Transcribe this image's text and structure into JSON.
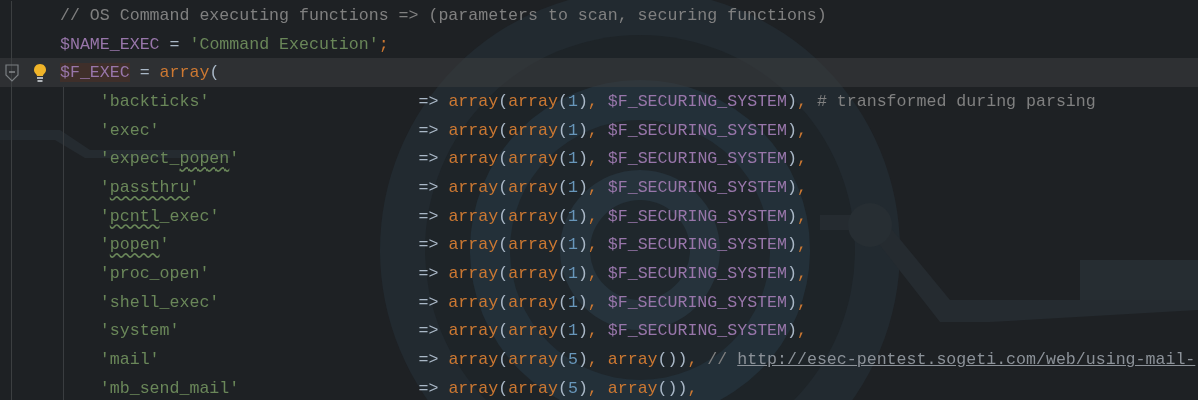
{
  "lines": [
    {
      "current": false,
      "tokens": [
        {
          "kind": "comment",
          "text": "// OS Command executing functions => (parameters to scan, securing functions)"
        }
      ]
    },
    {
      "current": false,
      "tokens": [
        {
          "kind": "variable",
          "text": "$NAME_EXEC"
        },
        {
          "kind": "plain",
          "text": " = "
        },
        {
          "kind": "string",
          "text": "'Command Execution'"
        },
        {
          "kind": "keyword",
          "text": ";"
        }
      ]
    },
    {
      "current": true,
      "fold_marker": true,
      "intention_bulb": true,
      "tokens": [
        {
          "kind": "variable",
          "text": "$F_EXEC",
          "highlight": true
        },
        {
          "kind": "plain",
          "text": " = "
        },
        {
          "kind": "keyword",
          "text": "array"
        },
        {
          "kind": "plain",
          "text": "("
        }
      ]
    },
    {
      "current": false,
      "tokens": [
        {
          "kind": "string",
          "text": "    'backticks'"
        },
        {
          "kind": "plain",
          "text": "                     => "
        },
        {
          "kind": "keyword",
          "text": "array"
        },
        {
          "kind": "plain",
          "text": "("
        },
        {
          "kind": "keyword",
          "text": "array"
        },
        {
          "kind": "plain",
          "text": "("
        },
        {
          "kind": "number",
          "text": "1"
        },
        {
          "kind": "plain",
          "text": ")"
        },
        {
          "kind": "keyword",
          "text": ", "
        },
        {
          "kind": "variable",
          "text": "$F_SECURING_SYSTEM"
        },
        {
          "kind": "plain",
          "text": ")"
        },
        {
          "kind": "keyword",
          "text": ", "
        },
        {
          "kind": "comment",
          "text": "# transformed during parsing"
        }
      ]
    },
    {
      "current": false,
      "tokens": [
        {
          "kind": "string",
          "text": "    'exec'"
        },
        {
          "kind": "plain",
          "text": "                          => "
        },
        {
          "kind": "keyword",
          "text": "array"
        },
        {
          "kind": "plain",
          "text": "("
        },
        {
          "kind": "keyword",
          "text": "array"
        },
        {
          "kind": "plain",
          "text": "("
        },
        {
          "kind": "number",
          "text": "1"
        },
        {
          "kind": "plain",
          "text": ")"
        },
        {
          "kind": "keyword",
          "text": ", "
        },
        {
          "kind": "variable",
          "text": "$F_SECURING_SYSTEM"
        },
        {
          "kind": "plain",
          "text": ")"
        },
        {
          "kind": "keyword",
          "text": ","
        }
      ]
    },
    {
      "current": false,
      "tokens": [
        {
          "kind": "string",
          "text": "    'expect_"
        },
        {
          "kind": "string",
          "text": "popen",
          "typo": true
        },
        {
          "kind": "string",
          "text": "'"
        },
        {
          "kind": "plain",
          "text": "                  => "
        },
        {
          "kind": "keyword",
          "text": "array"
        },
        {
          "kind": "plain",
          "text": "("
        },
        {
          "kind": "keyword",
          "text": "array"
        },
        {
          "kind": "plain",
          "text": "("
        },
        {
          "kind": "number",
          "text": "1"
        },
        {
          "kind": "plain",
          "text": ")"
        },
        {
          "kind": "keyword",
          "text": ", "
        },
        {
          "kind": "variable",
          "text": "$F_SECURING_SYSTEM"
        },
        {
          "kind": "plain",
          "text": ")"
        },
        {
          "kind": "keyword",
          "text": ","
        }
      ]
    },
    {
      "current": false,
      "tokens": [
        {
          "kind": "string",
          "text": "    '"
        },
        {
          "kind": "string",
          "text": "passthru",
          "typo": true
        },
        {
          "kind": "string",
          "text": "'"
        },
        {
          "kind": "plain",
          "text": "                      => "
        },
        {
          "kind": "keyword",
          "text": "array"
        },
        {
          "kind": "plain",
          "text": "("
        },
        {
          "kind": "keyword",
          "text": "array"
        },
        {
          "kind": "plain",
          "text": "("
        },
        {
          "kind": "number",
          "text": "1"
        },
        {
          "kind": "plain",
          "text": ")"
        },
        {
          "kind": "keyword",
          "text": ", "
        },
        {
          "kind": "variable",
          "text": "$F_SECURING_SYSTEM"
        },
        {
          "kind": "plain",
          "text": ")"
        },
        {
          "kind": "keyword",
          "text": ","
        }
      ]
    },
    {
      "current": false,
      "tokens": [
        {
          "kind": "string",
          "text": "    '"
        },
        {
          "kind": "string",
          "text": "pcntl",
          "typo": true
        },
        {
          "kind": "string",
          "text": "_exec'"
        },
        {
          "kind": "plain",
          "text": "                    => "
        },
        {
          "kind": "keyword",
          "text": "array"
        },
        {
          "kind": "plain",
          "text": "("
        },
        {
          "kind": "keyword",
          "text": "array"
        },
        {
          "kind": "plain",
          "text": "("
        },
        {
          "kind": "number",
          "text": "1"
        },
        {
          "kind": "plain",
          "text": ")"
        },
        {
          "kind": "keyword",
          "text": ", "
        },
        {
          "kind": "variable",
          "text": "$F_SECURING_SYSTEM"
        },
        {
          "kind": "plain",
          "text": ")"
        },
        {
          "kind": "keyword",
          "text": ","
        }
      ]
    },
    {
      "current": false,
      "tokens": [
        {
          "kind": "string",
          "text": "    '"
        },
        {
          "kind": "string",
          "text": "popen",
          "typo": true
        },
        {
          "kind": "string",
          "text": "'"
        },
        {
          "kind": "plain",
          "text": "                         => "
        },
        {
          "kind": "keyword",
          "text": "array"
        },
        {
          "kind": "plain",
          "text": "("
        },
        {
          "kind": "keyword",
          "text": "array"
        },
        {
          "kind": "plain",
          "text": "("
        },
        {
          "kind": "number",
          "text": "1"
        },
        {
          "kind": "plain",
          "text": ")"
        },
        {
          "kind": "keyword",
          "text": ", "
        },
        {
          "kind": "variable",
          "text": "$F_SECURING_SYSTEM"
        },
        {
          "kind": "plain",
          "text": ")"
        },
        {
          "kind": "keyword",
          "text": ","
        }
      ]
    },
    {
      "current": false,
      "tokens": [
        {
          "kind": "string",
          "text": "    'proc_open'"
        },
        {
          "kind": "plain",
          "text": "                     => "
        },
        {
          "kind": "keyword",
          "text": "array"
        },
        {
          "kind": "plain",
          "text": "("
        },
        {
          "kind": "keyword",
          "text": "array"
        },
        {
          "kind": "plain",
          "text": "("
        },
        {
          "kind": "number",
          "text": "1"
        },
        {
          "kind": "plain",
          "text": ")"
        },
        {
          "kind": "keyword",
          "text": ", "
        },
        {
          "kind": "variable",
          "text": "$F_SECURING_SYSTEM"
        },
        {
          "kind": "plain",
          "text": ")"
        },
        {
          "kind": "keyword",
          "text": ","
        }
      ]
    },
    {
      "current": false,
      "tokens": [
        {
          "kind": "string",
          "text": "    'shell_exec'"
        },
        {
          "kind": "plain",
          "text": "                    => "
        },
        {
          "kind": "keyword",
          "text": "array"
        },
        {
          "kind": "plain",
          "text": "("
        },
        {
          "kind": "keyword",
          "text": "array"
        },
        {
          "kind": "plain",
          "text": "("
        },
        {
          "kind": "number",
          "text": "1"
        },
        {
          "kind": "plain",
          "text": ")"
        },
        {
          "kind": "keyword",
          "text": ", "
        },
        {
          "kind": "variable",
          "text": "$F_SECURING_SYSTEM"
        },
        {
          "kind": "plain",
          "text": ")"
        },
        {
          "kind": "keyword",
          "text": ","
        }
      ]
    },
    {
      "current": false,
      "tokens": [
        {
          "kind": "string",
          "text": "    'system'"
        },
        {
          "kind": "plain",
          "text": "                        => "
        },
        {
          "kind": "keyword",
          "text": "array"
        },
        {
          "kind": "plain",
          "text": "("
        },
        {
          "kind": "keyword",
          "text": "array"
        },
        {
          "kind": "plain",
          "text": "("
        },
        {
          "kind": "number",
          "text": "1"
        },
        {
          "kind": "plain",
          "text": ")"
        },
        {
          "kind": "keyword",
          "text": ", "
        },
        {
          "kind": "variable",
          "text": "$F_SECURING_SYSTEM"
        },
        {
          "kind": "plain",
          "text": ")"
        },
        {
          "kind": "keyword",
          "text": ","
        }
      ]
    },
    {
      "current": false,
      "tokens": [
        {
          "kind": "string",
          "text": "    'mail'"
        },
        {
          "kind": "plain",
          "text": "                          => "
        },
        {
          "kind": "keyword",
          "text": "array"
        },
        {
          "kind": "plain",
          "text": "("
        },
        {
          "kind": "keyword",
          "text": "array"
        },
        {
          "kind": "plain",
          "text": "("
        },
        {
          "kind": "number",
          "text": "5"
        },
        {
          "kind": "plain",
          "text": ")"
        },
        {
          "kind": "keyword",
          "text": ", "
        },
        {
          "kind": "keyword",
          "text": "array"
        },
        {
          "kind": "plain",
          "text": "())"
        },
        {
          "kind": "keyword",
          "text": ", "
        },
        {
          "kind": "comment",
          "text": "// "
        }
      ],
      "link": "http://esec-pentest.sogeti.com/web/using-mail-"
    },
    {
      "current": false,
      "tokens": [
        {
          "kind": "string",
          "text": "    'mb_send_mail'"
        },
        {
          "kind": "plain",
          "text": "                  => "
        },
        {
          "kind": "keyword",
          "text": "array"
        },
        {
          "kind": "plain",
          "text": "("
        },
        {
          "kind": "keyword",
          "text": "array"
        },
        {
          "kind": "plain",
          "text": "("
        },
        {
          "kind": "number",
          "text": "5"
        },
        {
          "kind": "plain",
          "text": ")"
        },
        {
          "kind": "keyword",
          "text": ", "
        },
        {
          "kind": "keyword",
          "text": "array"
        },
        {
          "kind": "plain",
          "text": "())"
        },
        {
          "kind": "keyword",
          "text": ","
        }
      ]
    }
  ]
}
